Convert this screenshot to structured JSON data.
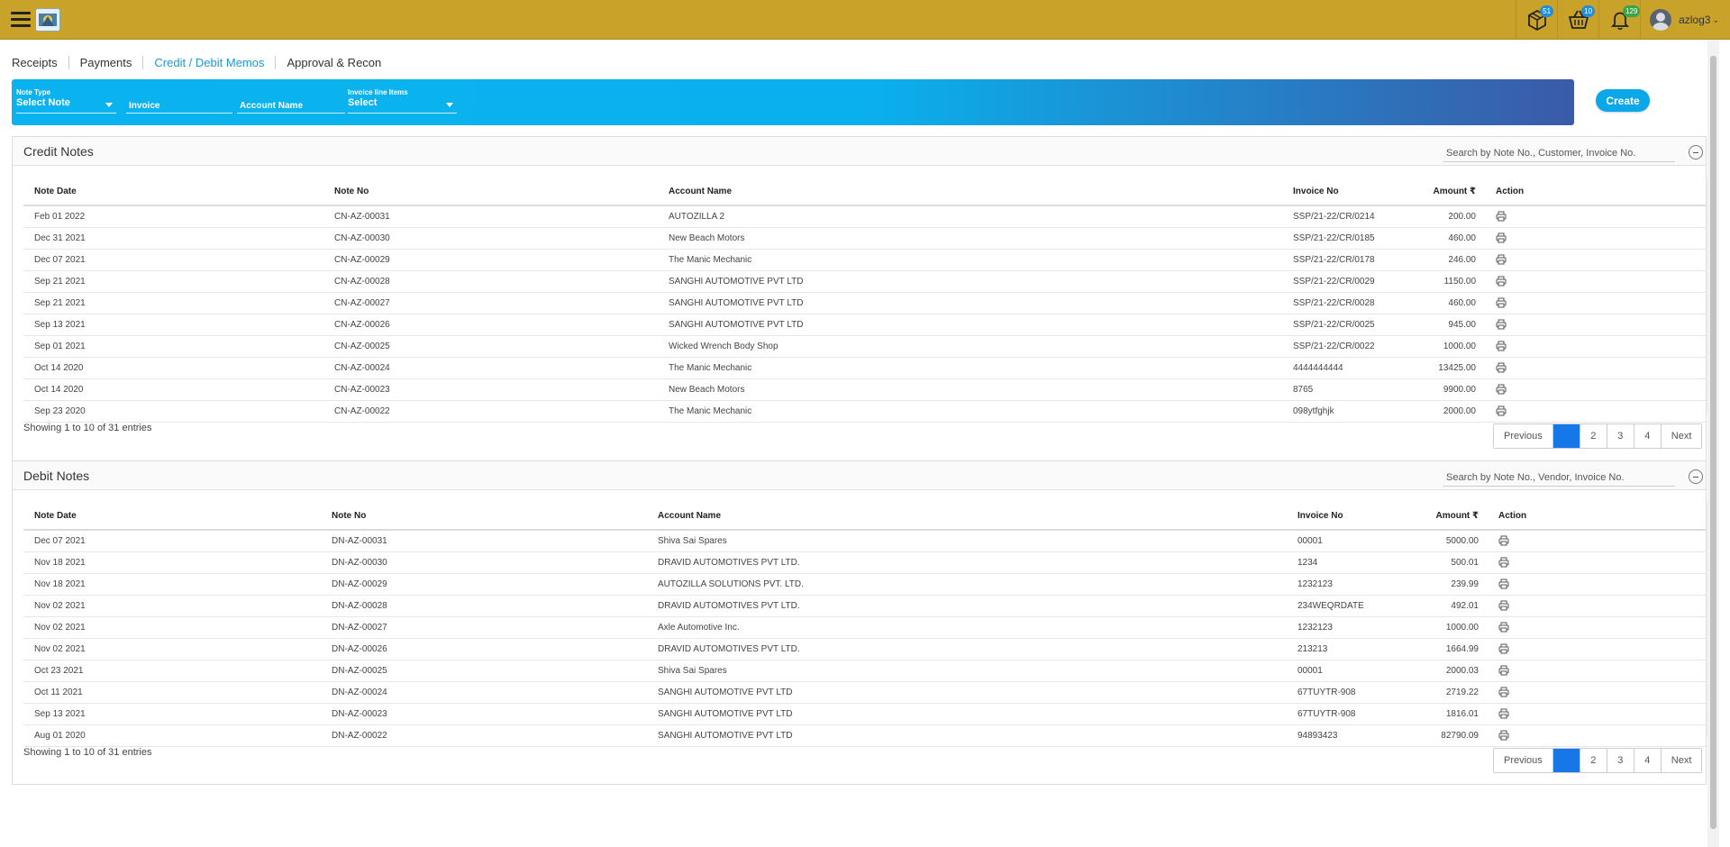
{
  "header": {
    "badges": {
      "package": "51",
      "basket": "10",
      "bell": "129"
    },
    "username": "azlog3"
  },
  "tabs": [
    {
      "label": "Receipts"
    },
    {
      "label": "Payments"
    },
    {
      "label": "Credit / Debit Memos"
    },
    {
      "label": "Approval & Recon"
    }
  ],
  "active_tab": "Credit / Debit Memos",
  "filters": {
    "note_type": {
      "label": "Note Type",
      "value": "Select Note"
    },
    "invoice": {
      "placeholder": "Invoice"
    },
    "account_name": {
      "placeholder": "Account Name"
    },
    "invoice_line_items": {
      "label": "Invoice line Items",
      "value": "Select"
    },
    "create_label": "Create"
  },
  "columns": {
    "note_date": "Note Date",
    "note_no": "Note No",
    "account_name": "Account Name",
    "invoice_no": "Invoice No",
    "amount": "Amount ₹",
    "action": "Action"
  },
  "credit": {
    "title": "Credit Notes",
    "search_placeholder": "Search by Note No., Customer, Invoice No.",
    "rows": [
      [
        "Feb 01 2022",
        "CN-AZ-00031",
        "AUTOZILLA 2",
        "SSP/21-22/CR/0214",
        "200.00"
      ],
      [
        "Dec 31 2021",
        "CN-AZ-00030",
        "New Beach Motors",
        "SSP/21-22/CR/0185",
        "460.00"
      ],
      [
        "Dec 07 2021",
        "CN-AZ-00029",
        "The Manic Mechanic",
        "SSP/21-22/CR/0178",
        "246.00"
      ],
      [
        "Sep 21 2021",
        "CN-AZ-00028",
        "SANGHI AUTOMOTIVE PVT LTD",
        "SSP/21-22/CR/0029",
        "1150.00"
      ],
      [
        "Sep 21 2021",
        "CN-AZ-00027",
        "SANGHI AUTOMOTIVE PVT LTD",
        "SSP/21-22/CR/0028",
        "460.00"
      ],
      [
        "Sep 13 2021",
        "CN-AZ-00026",
        "SANGHI AUTOMOTIVE PVT LTD",
        "SSP/21-22/CR/0025",
        "945.00"
      ],
      [
        "Sep 01 2021",
        "CN-AZ-00025",
        "Wicked Wrench Body Shop",
        "SSP/21-22/CR/0022",
        "1000.00"
      ],
      [
        "Oct 14 2020",
        "CN-AZ-00024",
        "The Manic Mechanic",
        "4444444444",
        "13425.00"
      ],
      [
        "Oct 14 2020",
        "CN-AZ-00023",
        "New Beach Motors",
        "8765",
        "9900.00"
      ],
      [
        "Sep 23 2020",
        "CN-AZ-00022",
        "The Manic Mechanic",
        "098ytfghjk",
        "2000.00"
      ]
    ],
    "showing": "Showing 1 to 10 of 31 entries"
  },
  "debit": {
    "title": "Debit Notes",
    "search_placeholder": "Search by Note No., Vendor, Invoice No.",
    "rows": [
      [
        "Dec 07 2021",
        "DN-AZ-00031",
        "Shiva Sai Spares",
        "00001",
        "5000.00"
      ],
      [
        "Nov 18 2021",
        "DN-AZ-00030",
        "DRAVID AUTOMOTIVES PVT LTD.",
        "1234",
        "500.01"
      ],
      [
        "Nov 18 2021",
        "DN-AZ-00029",
        "AUTOZILLA SOLUTIONS PVT. LTD.",
        "1232123",
        "239.99"
      ],
      [
        "Nov 02 2021",
        "DN-AZ-00028",
        "DRAVID AUTOMOTIVES PVT LTD.",
        "234WEQRDATE",
        "492.01"
      ],
      [
        "Nov 02 2021",
        "DN-AZ-00027",
        "Axle Automotive Inc.",
        "1232123",
        "1000.00"
      ],
      [
        "Nov 02 2021",
        "DN-AZ-00026",
        "DRAVID AUTOMOTIVES PVT LTD.",
        "213213",
        "1664.99"
      ],
      [
        "Oct 23 2021",
        "DN-AZ-00025",
        "Shiva Sai Spares",
        "00001",
        "2000.03"
      ],
      [
        "Oct 11 2021",
        "DN-AZ-00024",
        "SANGHI AUTOMOTIVE PVT LTD",
        "67TUYTR-908",
        "2719.22"
      ],
      [
        "Sep 13 2021",
        "DN-AZ-00023",
        "SANGHI AUTOMOTIVE PVT LTD",
        "67TUYTR-908",
        "1816.01"
      ],
      [
        "Aug 01 2020",
        "DN-AZ-00022",
        "SANGHI AUTOMOTIVE PVT LTD",
        "94893423",
        "82790.09"
      ]
    ],
    "showing": "Showing 1 to 10 of 31 entries"
  },
  "pagination": {
    "previous": "Previous",
    "pages": [
      "1",
      "2",
      "3",
      "4"
    ],
    "next": "Next",
    "active_page": "1"
  },
  "colors": {
    "topbar": "#c9a22a",
    "accent": "#1a9ad6",
    "gradient_start": "#0ab3ef",
    "gradient_end": "#3b5aa8",
    "page_active": "#1577e8"
  },
  "icons": [
    "menu-icon",
    "app-logo",
    "package-icon",
    "basket-icon",
    "bell-icon",
    "user-avatar",
    "chevron-down-icon",
    "close-icon",
    "collapse-icon",
    "print-icon"
  ]
}
